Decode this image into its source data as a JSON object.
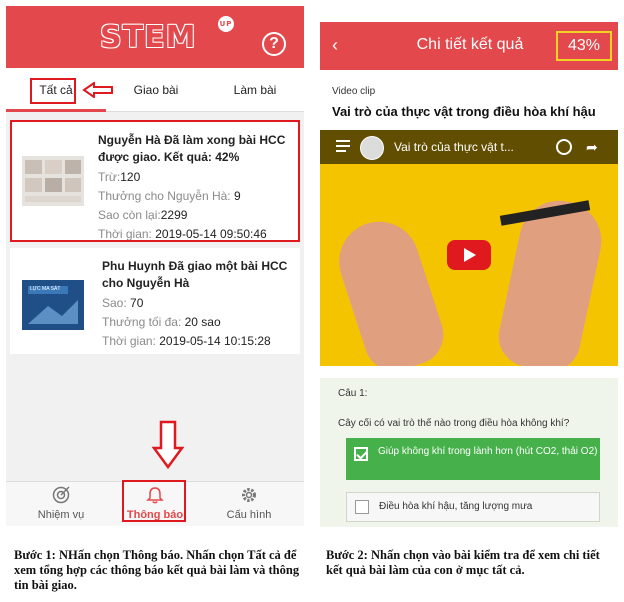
{
  "left_screen": {
    "logo_text": "STEM",
    "logo_badge": "UP",
    "help_glyph": "?",
    "tabs": [
      "Tất cả",
      "Giao bài",
      "Làm bài"
    ],
    "notifications": [
      {
        "title": "Nguyễn Hà Đã làm xong bài HCC được giao. Kết quả: 42%",
        "rows": [
          {
            "label": "Trừ:",
            "value": "120"
          },
          {
            "label": "Thưởng cho Nguyễn Hà:",
            "value": "9"
          },
          {
            "label": "Sao còn lại:",
            "value": "2299"
          },
          {
            "label": "Thời gian:",
            "value": "2019-05-14 09:50:46"
          }
        ]
      },
      {
        "title": "Phu Huynh Đã giao một bài HCC cho Nguyễn Hà",
        "thumb_text": "LỰC MA SÁT",
        "rows": [
          {
            "label": "Sao:",
            "value": "70"
          },
          {
            "label": "Thưởng tối đa:",
            "value": "20 sao"
          },
          {
            "label": "Thời gian:",
            "value": "2019-05-14 10:15:28"
          }
        ]
      }
    ],
    "bottom_nav": [
      {
        "label": "Nhiệm vụ",
        "icon": "target-icon"
      },
      {
        "label": "Thông báo",
        "icon": "bell-icon"
      },
      {
        "label": "Cấu hình",
        "icon": "gear-icon"
      }
    ],
    "caption": "Bước 1: NHấn chọn Thông báo. Nhấn chọn Tất cả để xem tổng hợp các thông báo kết quả bài làm và thông tin bài giao."
  },
  "right_screen": {
    "back_glyph": "‹",
    "title": "Chi tiết kết quả",
    "score": "43%",
    "video_label": "Video clip",
    "video_heading": "Vai trò của thực vật trong điều hòa khí hậu",
    "video_player_title": "Vai trò của thực vật t...",
    "question_number": "Câu 1:",
    "question_text": "Cây cối có vai trò thế nào trong điều hòa không khí?",
    "options": [
      {
        "text": "Giúp không khí trong lành hơn (hút CO2, thải O2)",
        "correct": true
      },
      {
        "text": "Điều hòa khí hậu, tăng lượng mưa",
        "correct": false
      }
    ],
    "caption": "Bước 2: Nhấn chọn vào bài kiểm tra để xem chi tiết kết quả bài làm của con ở mục tất cả."
  },
  "colors": {
    "brand_red": "#e2484c",
    "highlight_red": "#e0191f",
    "score_yellow": "#f3d226",
    "correct_green": "#46b04a"
  }
}
